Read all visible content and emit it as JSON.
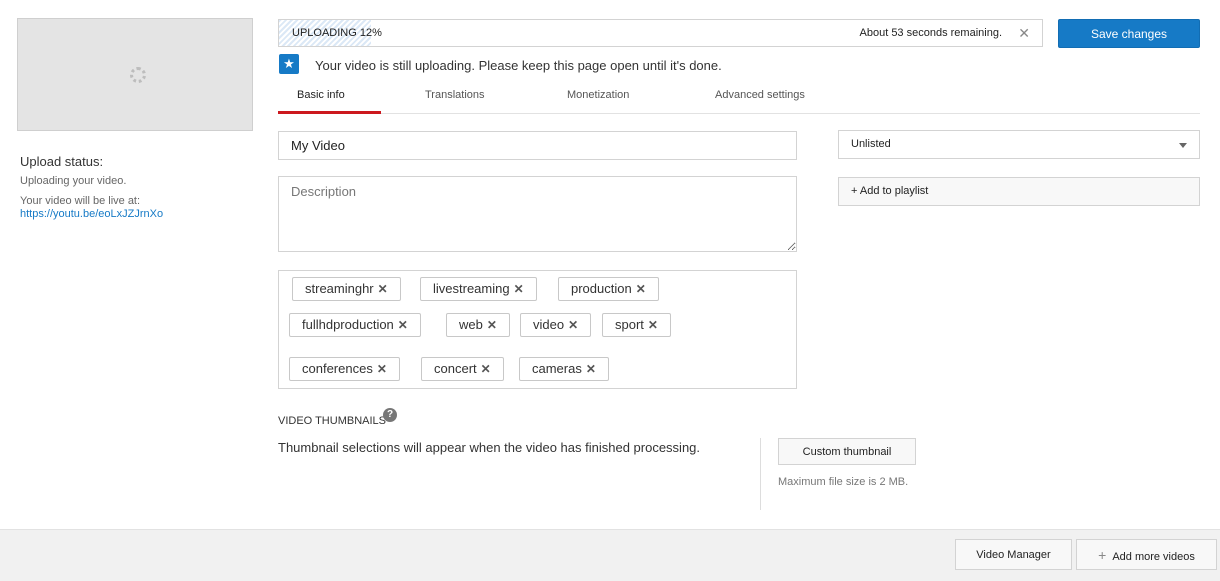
{
  "sidebar": {
    "status_title": "Upload status:",
    "status_line": "Uploading your video.",
    "live_label": "Your video will be live at:",
    "live_link": "https://youtu.be/eoLxJZJrnXo"
  },
  "upload": {
    "label": "UPLOADING 12%",
    "progress_fraction": 0.12,
    "remaining": "About 53 seconds remaining.",
    "close_icon": "close-icon"
  },
  "toolbar": {
    "save_label": "Save changes"
  },
  "notice": {
    "icon": "star-icon",
    "text": "Your video is still uploading. Please keep this page open until it's done."
  },
  "tabs": [
    {
      "label": "Basic info",
      "active": true
    },
    {
      "label": "Translations",
      "active": false
    },
    {
      "label": "Monetization",
      "active": false
    },
    {
      "label": "Advanced settings",
      "active": false
    }
  ],
  "form": {
    "title_value": "My Video",
    "description_placeholder": "Description"
  },
  "tags": [
    "streaminghr",
    "livestreaming",
    "production",
    "fullhdproduction",
    "web",
    "video",
    "sport",
    "conferences",
    "concert",
    "cameras"
  ],
  "privacy": {
    "selected": "Unlisted"
  },
  "playlist": {
    "label": "+ Add to playlist"
  },
  "thumbnails": {
    "title": "VIDEO THUMBNAILS",
    "help_icon": "question-icon",
    "description": "Thumbnail selections will appear when the video has finished processing.",
    "custom_label": "Custom thumbnail",
    "max_size": "Maximum file size is 2 MB."
  },
  "footer": {
    "manager_label": "Video Manager",
    "more_label": "Add more videos"
  },
  "colors": {
    "accent": "#167ac6",
    "tab_underline": "#cc181e"
  }
}
